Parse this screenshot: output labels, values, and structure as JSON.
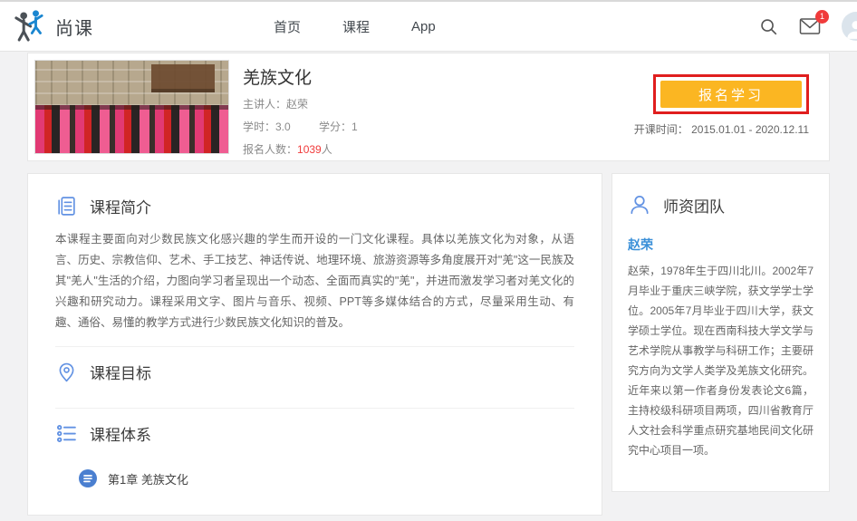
{
  "colors": {
    "accent-blue": "#6292e3",
    "brand-blue": "#1a86d0",
    "accent-yellow": "#fbb622",
    "annotation-red": "#e01e1e",
    "count-red": "#f03b3b",
    "link-blue": "#3a8fd8"
  },
  "header": {
    "brand": "尚课",
    "nav": [
      {
        "label": "首页"
      },
      {
        "label": "课程"
      },
      {
        "label": "App"
      }
    ],
    "mail_badge": "1"
  },
  "hero": {
    "title": "羌族文化",
    "lecturer": "主讲人：赵荣",
    "hours": "学时：3.0",
    "credits": "学分：1",
    "enroll_count_label": "报名人数：",
    "enroll_count": "1039",
    "enroll_count_unit": "人",
    "enroll_button": "报名学习",
    "schedule_label": "开课时间：",
    "schedule_value": "2015.01.01 - 2020.12.11"
  },
  "sections": {
    "intro": {
      "title": "课程简介",
      "body": "本课程主要面向对少数民族文化感兴趣的学生而开设的一门文化课程。具体以羌族文化为对象，从语言、历史、宗教信仰、艺术、手工技艺、神话传说、地理环境、旅游资源等多角度展开对\"羌\"这一民族及其\"羌人\"生活的介绍，力图向学习者呈现出一个动态、全面而真实的\"羌\"，并进而激发学习者对羌文化的兴趣和研究动力。课程采用文字、图片与音乐、视频、PPT等多媒体结合的方式，尽量采用生动、有趣、通俗、易懂的教学方式进行少数民族文化知识的普及。"
    },
    "goals": {
      "title": "课程目标"
    },
    "system": {
      "title": "课程体系",
      "chapters": [
        {
          "label": "第1章 羌族文化"
        }
      ]
    }
  },
  "sidebar": {
    "title": "师资团队",
    "teacher_name": "赵荣",
    "teacher_bio": "赵荣，1978年生于四川北川。2002年7月毕业于重庆三峡学院，获文学学士学位。2005年7月毕业于四川大学，获文学硕士学位。现在西南科技大学文学与艺术学院从事教学与科研工作；主要研究方向为文学人类学及羌族文化研究。近年来以第一作者身份发表论文6篇，主持校级科研项目两项，四川省教育厅人文社会科学重点研究基地民间文化研究中心项目一项。"
  }
}
